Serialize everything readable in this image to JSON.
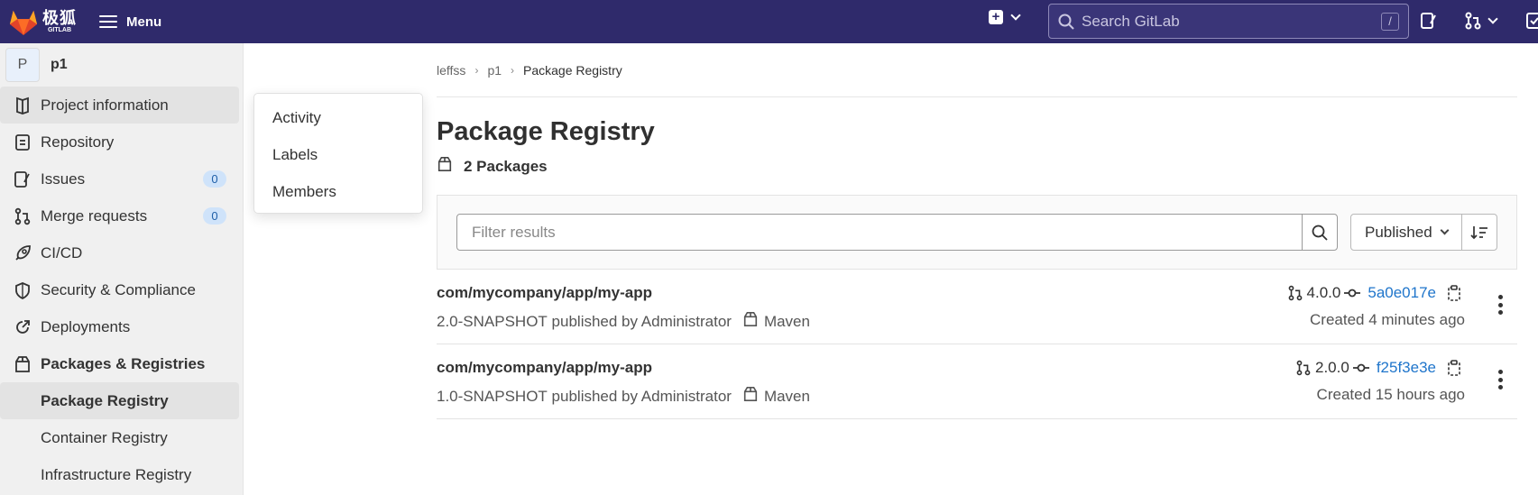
{
  "topbar": {
    "logo_cn": "极狐",
    "logo_en": "GITLAB",
    "menu_label": "Menu",
    "search_placeholder": "Search GitLab",
    "search_shortcut": "/"
  },
  "sidebar": {
    "project_avatar": "P",
    "project_name": "p1",
    "items": [
      {
        "label": "Project information",
        "icon": "project-info-icon"
      },
      {
        "label": "Repository",
        "icon": "repository-icon"
      },
      {
        "label": "Issues",
        "icon": "issues-icon",
        "badge": "0"
      },
      {
        "label": "Merge requests",
        "icon": "merge-request-icon",
        "badge": "0"
      },
      {
        "label": "CI/CD",
        "icon": "rocket-icon"
      },
      {
        "label": "Security & Compliance",
        "icon": "shield-icon"
      },
      {
        "label": "Deployments",
        "icon": "deployments-icon"
      },
      {
        "label": "Packages & Registries",
        "icon": "package-icon"
      }
    ],
    "sub_items": [
      {
        "label": "Package Registry"
      },
      {
        "label": "Container Registry"
      },
      {
        "label": "Infrastructure Registry"
      }
    ]
  },
  "flyout": {
    "items": [
      "Activity",
      "Labels",
      "Members"
    ]
  },
  "breadcrumb": {
    "items": [
      "leffss",
      "p1",
      "Package Registry"
    ]
  },
  "main": {
    "title": "Package Registry",
    "package_count": "2 Packages",
    "filter_placeholder": "Filter results",
    "sort_label": "Published"
  },
  "packages": [
    {
      "name": "com/mycompany/app/my-app",
      "version": "2.0-SNAPSHOT",
      "published_by": "published by Administrator",
      "type": "Maven",
      "branch": "4.0.0",
      "commit": "5a0e017e",
      "created": "Created 4 minutes ago"
    },
    {
      "name": "com/mycompany/app/my-app",
      "version": "1.0-SNAPSHOT",
      "published_by": "published by Administrator",
      "type": "Maven",
      "branch": "2.0.0",
      "commit": "f25f3e3e",
      "created": "Created 15 hours ago"
    }
  ]
}
